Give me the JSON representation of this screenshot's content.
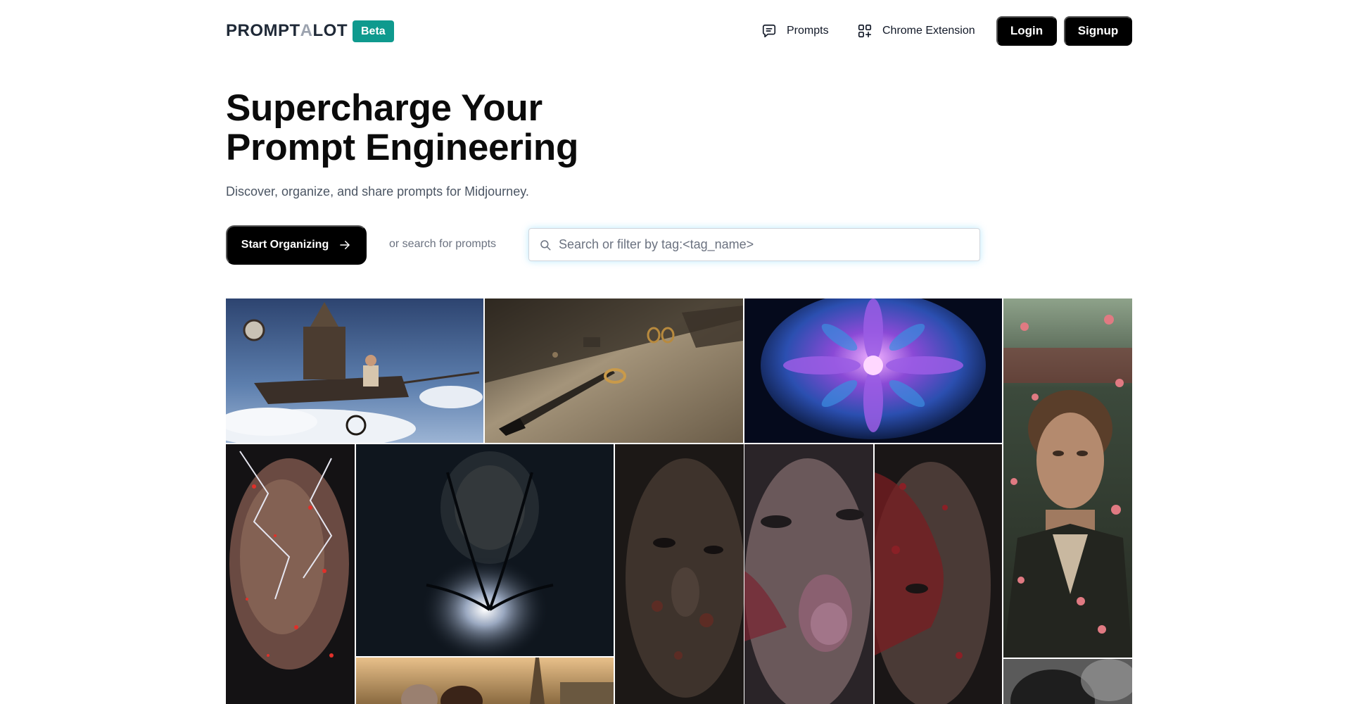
{
  "brand": {
    "logo_part1": "PROMPT",
    "logo_part2": "A",
    "logo_part3": "LOT",
    "badge": "Beta",
    "badge_color": "#0f9a8e"
  },
  "nav": {
    "prompts_label": "Prompts",
    "prompts_icon": "message-square-icon",
    "extension_label": "Chrome Extension",
    "extension_icon": "grid-plus-icon",
    "login_label": "Login",
    "signup_label": "Signup"
  },
  "hero": {
    "title_line1": "Supercharge Your",
    "title_line2": "Prompt Engineering",
    "subtitle": "Discover, organize, and share prompts for Midjourney.",
    "cta_label": "Start Organizing",
    "cta_icon": "arrow-right-icon",
    "or_text": "or search for prompts"
  },
  "search": {
    "placeholder": "Search or filter by tag:<tag_name>",
    "value": "",
    "icon": "search-icon"
  },
  "gallery": {
    "images": [
      {
        "subject": "steampunk-flying-machine",
        "accent": "#4a6a9a"
      },
      {
        "subject": "dagger-and-rings-on-stone",
        "accent": "#8a7a60"
      },
      {
        "subject": "fractal-purple-flower",
        "accent": "#7a4ad0"
      },
      {
        "subject": "man-with-falling-petals",
        "accent": "#7a8a70"
      },
      {
        "subject": "face-with-red-lightning",
        "accent": "#5a3030"
      },
      {
        "subject": "dark-figure-glowing-heart",
        "accent": "#1a2028"
      },
      {
        "subject": "dark-face-closeup",
        "accent": "#2a2220"
      },
      {
        "subject": "bloodied-face-closeup",
        "accent": "#5a3a40"
      },
      {
        "subject": "wounded-face-closeup",
        "accent": "#3a3030"
      },
      {
        "subject": "figures-near-eiffel-tower",
        "accent": "#c08a50"
      },
      {
        "subject": "dark-hair-portrait",
        "accent": "#2a2a2a"
      }
    ]
  }
}
